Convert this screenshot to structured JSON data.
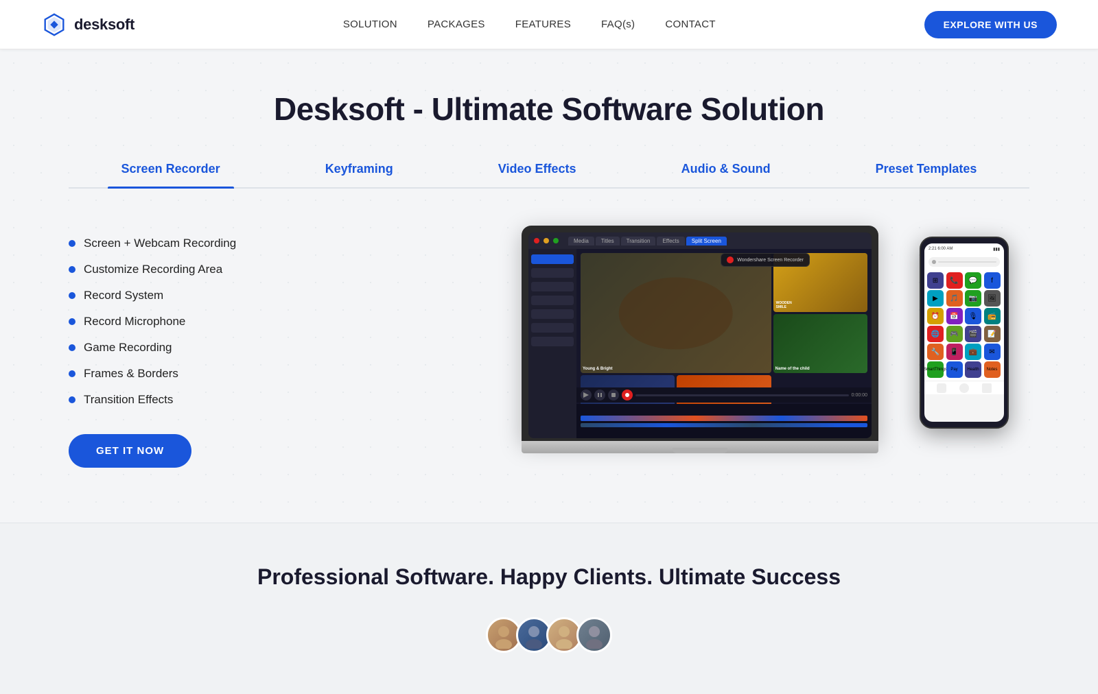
{
  "navbar": {
    "logo_text": "desksoft",
    "nav_items": [
      {
        "label": "SOLUTION",
        "href": "#"
      },
      {
        "label": "PACKAGES",
        "href": "#"
      },
      {
        "label": "FEATURES",
        "href": "#"
      },
      {
        "label": "FAQ(s)",
        "href": "#"
      },
      {
        "label": "CONTACT",
        "href": "#"
      }
    ],
    "cta_label": "EXPLORE WITH US"
  },
  "hero": {
    "title": "Desksoft - Ultimate Software Solution",
    "tabs": [
      {
        "label": "Screen Recorder",
        "active": true
      },
      {
        "label": "Keyframing",
        "active": false
      },
      {
        "label": "Video Effects",
        "active": false
      },
      {
        "label": "Audio & Sound",
        "active": false
      },
      {
        "label": "Preset Templates",
        "active": false
      }
    ],
    "features": [
      "Screen + Webcam Recording",
      "Customize Recording Area",
      "Record System",
      "Record Microphone",
      "Game Recording",
      "Frames & Borders",
      "Transition Effects"
    ],
    "cta_label": "GET IT NOW"
  },
  "stats": {
    "title": "Professional Software. Happy Clients. Ultimate Success",
    "avatars": [
      "👤",
      "👤",
      "👤",
      "👤"
    ]
  }
}
